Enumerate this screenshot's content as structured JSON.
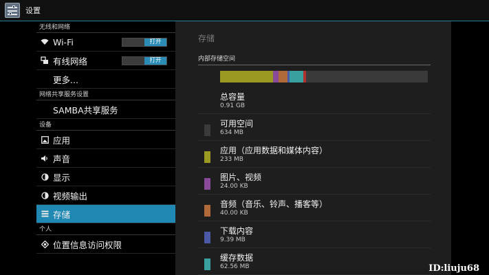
{
  "app": {
    "title": "设置",
    "icon": "settings-app-icon"
  },
  "sidebar": {
    "groups": [
      {
        "header": "无线和网络",
        "items": [
          {
            "label": "Wi-Fi",
            "icon": "wifi-icon",
            "toggle": "打开"
          },
          {
            "label": "有线网络",
            "icon": "ethernet-icon",
            "toggle": "打开"
          },
          {
            "label": "更多...",
            "icon": ""
          }
        ]
      },
      {
        "header": "网络共享服务设置",
        "items": [
          {
            "label": "SAMBA共享服务",
            "icon": ""
          }
        ]
      },
      {
        "header": "设备",
        "items": [
          {
            "label": "应用",
            "icon": "apps-icon"
          },
          {
            "label": "声音",
            "icon": "speaker-icon"
          },
          {
            "label": "显示",
            "icon": "brightness-icon"
          },
          {
            "label": "视频输出",
            "icon": "video-output-icon"
          },
          {
            "label": "存储",
            "icon": "storage-icon",
            "selected": true
          }
        ]
      },
      {
        "header": "个人",
        "items": [
          {
            "label": "位置信息访问权限",
            "icon": "location-icon"
          }
        ]
      }
    ]
  },
  "storage": {
    "title": "存储",
    "section_header": "内部存储空间",
    "usage_bar": {
      "segments": [
        {
          "fraction": 0.255,
          "color": "#9a9a22"
        },
        {
          "fraction": 0.026,
          "color": "#8a4a9a"
        },
        {
          "fraction": 0.043,
          "color": "#b06a3a"
        },
        {
          "fraction": 0.01,
          "color": "#4a5aa8"
        },
        {
          "fraction": 0.067,
          "color": "#3aa0a0"
        },
        {
          "fraction": 0.012,
          "color": "#b03030"
        }
      ]
    },
    "rows": [
      {
        "name": "总容量",
        "size": "0.91 GB",
        "color": ""
      },
      {
        "name": "可用空间",
        "size": "634 MB",
        "color": "#3a3a3a"
      },
      {
        "name": "应用（应用数据和媒体内容）",
        "size": "233 MB",
        "color": "#9a9a22"
      },
      {
        "name": "图片、视频",
        "size": "24.00 KB",
        "color": "#8a4a9a"
      },
      {
        "name": "音频（音乐、铃声、播客等）",
        "size": "40.00 KB",
        "color": "#b06a3a"
      },
      {
        "name": "下载内容",
        "size": "9.39 MB",
        "color": "#4a5aa8"
      },
      {
        "name": "缓存数据",
        "size": "62.56 MB",
        "color": "#3aa0a0"
      }
    ]
  },
  "watermark": "ID:liuju68"
}
